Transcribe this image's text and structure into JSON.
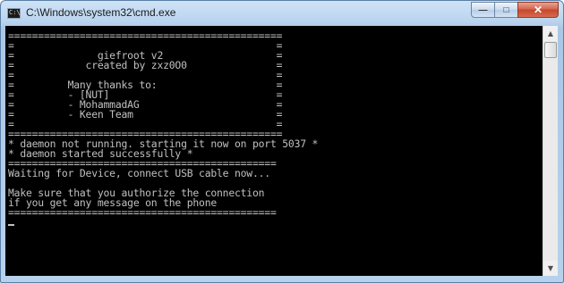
{
  "window": {
    "title": "C:\\Windows\\system32\\cmd.exe",
    "icon_label": "C:\\",
    "minimize_glyph": "—",
    "maximize_glyph": "□",
    "close_glyph": "✕"
  },
  "console": {
    "lines": [
      "==============================================",
      "=                                            =",
      "=              giefroot v2                   =",
      "=            created by zxz0O0               =",
      "=                                            =",
      "=         Many thanks to:                    =",
      "=         - [NUT]                            =",
      "=         - MohammadAG                       =",
      "=         - Keen Team                        =",
      "=                                            =",
      "==============================================",
      "* daemon not running. starting it now on port 5037 *",
      "* daemon started successfully *",
      "=============================================",
      "Waiting for Device, connect USB cable now...",
      "",
      "Make sure that you authorize the connection",
      "if you get any message on the phone",
      "============================================="
    ]
  },
  "scrollbar": {
    "up_glyph": "▲",
    "down_glyph": "▼"
  }
}
